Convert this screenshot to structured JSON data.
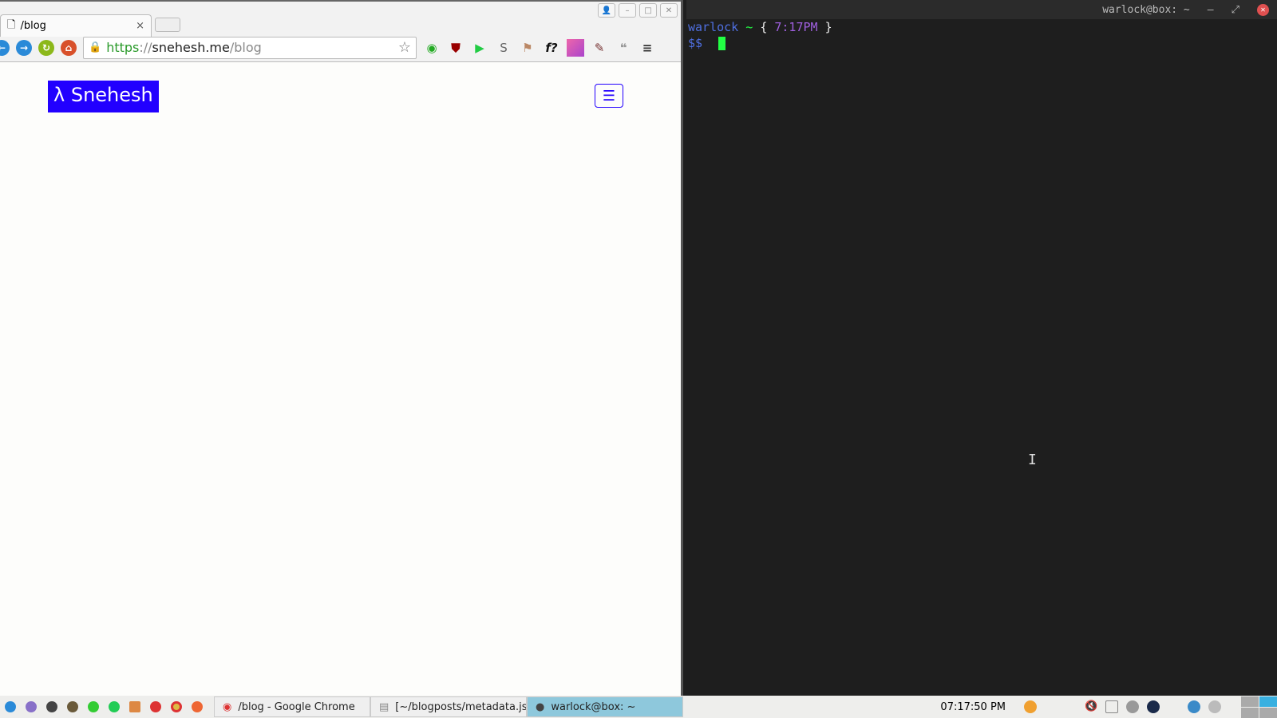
{
  "browser": {
    "tab": {
      "title": "/blog",
      "close": "×"
    },
    "url": {
      "scheme": "https",
      "sep": "://",
      "host": "snehesh.me",
      "path": "/blog"
    },
    "nav": [
      "back-icon",
      "forward-icon",
      "reload-icon",
      "home-icon"
    ],
    "extensions": [
      "ext-1",
      "ublock-origin",
      "pushbullet",
      "s-ext",
      "signpost",
      "fontface-ninja",
      "color-palette",
      "eyedropper",
      "hangouts"
    ],
    "window_buttons": [
      "profile-icon",
      "minimize-icon",
      "maximize-icon",
      "close-icon"
    ],
    "page": {
      "logo": "λ Snehesh",
      "menu_icon": "☰"
    }
  },
  "terminal": {
    "title": "warlock@box: ~",
    "prompt": {
      "user": "warlock",
      "tilde": "~",
      "open": "{",
      "time": "7:17PM",
      "close": "}"
    },
    "ps": "$$",
    "colors": {
      "user": "#4f6fe0",
      "tilde": "#22ff44",
      "time": "#a060e0",
      "cursor": "#22ff44"
    }
  },
  "taskbar": {
    "tasks": [
      {
        "label": "/blog - Google Chrome"
      },
      {
        "label": "[~/blogposts/metadata.js..."
      },
      {
        "label": "warlock@box: ~"
      }
    ],
    "clock": "07:17:50 PM"
  }
}
